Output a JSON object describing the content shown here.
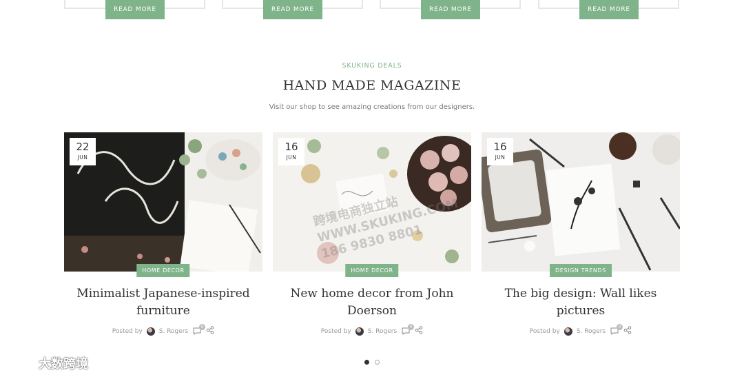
{
  "top_cards": {
    "read_more_labels": [
      "READ MORE",
      "READ MORE",
      "READ MORE",
      "READ MORE"
    ]
  },
  "section": {
    "tag": "SKUKING DEALS",
    "title": "HAND MADE MAGAZINE",
    "description": "Visit our shop to see amazing creations from our designers."
  },
  "posts": [
    {
      "day": "22",
      "month": "JUN",
      "category": "HOME DECOR",
      "title_line1": "Minimalist Japanese-inspired",
      "title_line2": "furniture",
      "posted_by": "Posted by",
      "author": "S. Rogers",
      "comments": "0",
      "image_desc": "thank-you-chalkboard-flatlay"
    },
    {
      "day": "16",
      "month": "JUN",
      "category": "HOME DECOR",
      "title_line1": "New home decor from John",
      "title_line2": "Doerson",
      "posted_by": "Posted by",
      "author": "S. Rogers",
      "comments": "0",
      "image_desc": "christmas-ornaments-flatlay"
    },
    {
      "day": "16",
      "month": "JUN",
      "category": "DESIGN TRENDS",
      "title_line1": "The big design: Wall likes",
      "title_line2": "pictures",
      "posted_by": "Posted by",
      "author": "S. Rogers",
      "comments": "0",
      "image_desc": "art-brushes-frame-flatlay"
    }
  ],
  "carousel": {
    "pages": 2,
    "active": 1
  },
  "overlay": {
    "brand": "大数跨境",
    "watermark_line1": "跨境电商独立站",
    "watermark_line2": "WWW.SKUKING.COM",
    "watermark_line3": "186 9830 8801"
  },
  "colors": {
    "accent": "#7fb38a",
    "text": "#333333"
  }
}
